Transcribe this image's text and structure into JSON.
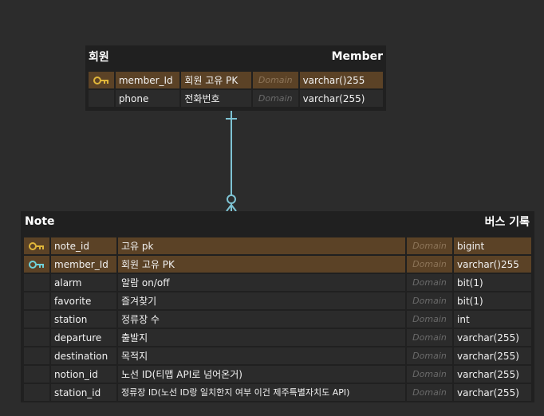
{
  "member_table": {
    "logical_name": "회원",
    "physical_name": "Member",
    "columns": [
      {
        "key": "pk",
        "name": "member_Id",
        "comment": "회원 고유 PK",
        "domain": "Domain",
        "type": "varchar()255"
      },
      {
        "key": "",
        "name": "phone",
        "comment": "전화번호",
        "domain": "Domain",
        "type": "varchar(255)"
      }
    ]
  },
  "note_table": {
    "logical_name": "Note",
    "physical_name": "버스 기록",
    "columns": [
      {
        "key": "pk",
        "name": "note_id",
        "comment": "고유 pk",
        "domain": "Domain",
        "type": "bigint"
      },
      {
        "key": "fk",
        "name": "member_Id",
        "comment": "회원 고유 PK",
        "domain": "Domain",
        "type": "varchar()255"
      },
      {
        "key": "",
        "name": "alarm",
        "comment": "알람 on/off",
        "domain": "Domain",
        "type": "bit(1)"
      },
      {
        "key": "",
        "name": "favorite",
        "comment": "즐겨찾기",
        "domain": "Domain",
        "type": "bit(1)"
      },
      {
        "key": "",
        "name": "station",
        "comment": "정류장 수",
        "domain": "Domain",
        "type": "int"
      },
      {
        "key": "",
        "name": "departure",
        "comment": "출발지",
        "domain": "Domain",
        "type": "varchar(255)"
      },
      {
        "key": "",
        "name": "destination",
        "comment": "목적지",
        "domain": "Domain",
        "type": "varchar(255)"
      },
      {
        "key": "",
        "name": "notion_id",
        "comment": "노선 ID(티맵 API로 넘어온거)",
        "domain": "Domain",
        "type": "varchar(255)"
      },
      {
        "key": "",
        "name": "station_id",
        "comment": "정류장 ID(노선 ID랑 일치한지 여부 이건 제주특별자치도 API)",
        "domain": "Domain",
        "type": "varchar(255)"
      }
    ]
  },
  "relationship": {
    "from": "Member",
    "to": "Note",
    "cardinality": "one-to-zero-or-many"
  },
  "colors": {
    "background": "#2c2c2c",
    "table_bg": "#202020",
    "key_row": "#5b4226",
    "pk_key_icon": "#e0b63a",
    "fk_key_icon": "#6fd0d8",
    "relationship_line": "#7ec3d3"
  }
}
